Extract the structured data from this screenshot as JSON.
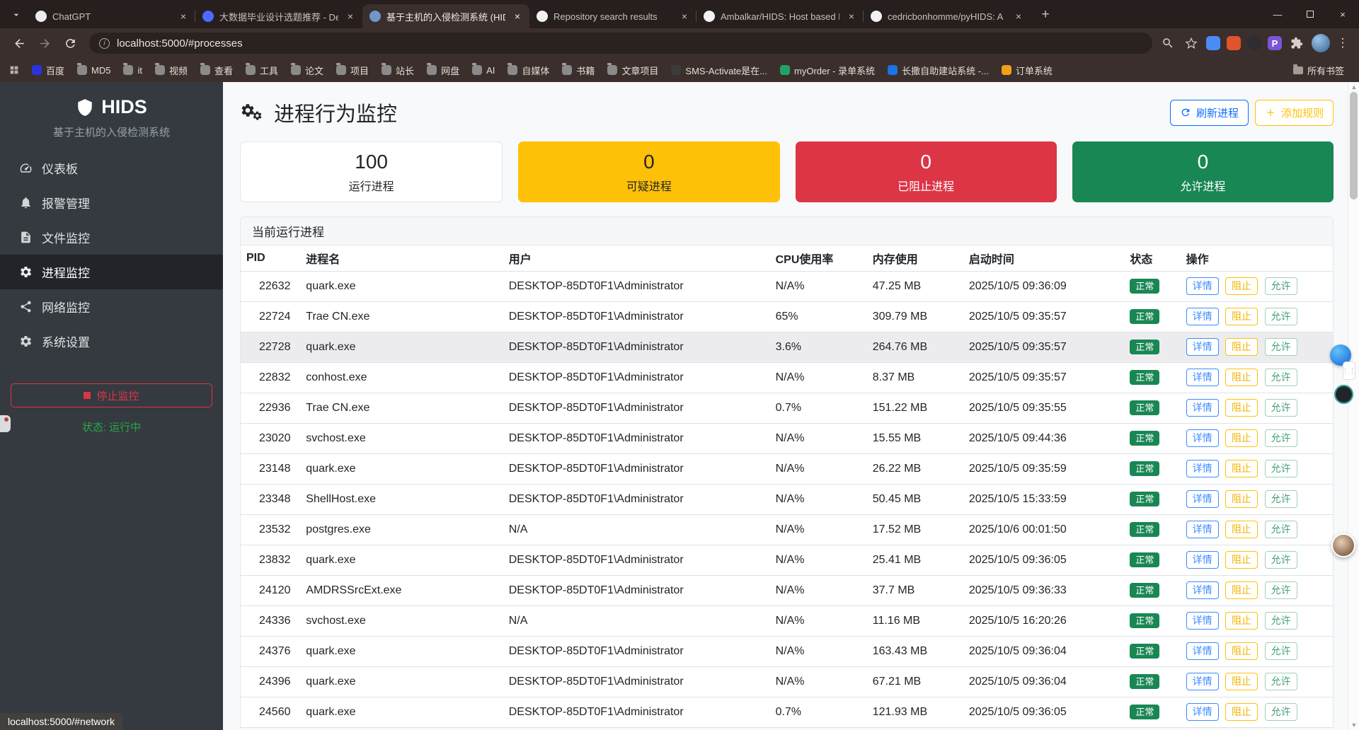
{
  "colors": {
    "primary": "#0d6efd",
    "warning": "#ffc107",
    "danger": "#dc3545",
    "success": "#198754",
    "sidebar_bg": "#343a40",
    "running_status": "#28a745"
  },
  "browser": {
    "tabs": [
      {
        "title": "ChatGPT",
        "favicon": "chatgpt",
        "active": false
      },
      {
        "title": "大数据毕业设计选题推荐 - Dee",
        "favicon": "deepseek",
        "active": false
      },
      {
        "title": "基于主机的入侵检测系统 (HID",
        "favicon": "hids",
        "active": true
      },
      {
        "title": "Repository search results",
        "favicon": "github",
        "active": false
      },
      {
        "title": "Ambalkar/HIDS: Host based I",
        "favicon": "github",
        "active": false
      },
      {
        "title": "cedricbonhomme/pyHIDS: A",
        "favicon": "github",
        "active": false
      }
    ],
    "url": "localhost:5000/#processes",
    "bookmarks": [
      {
        "label": "百度",
        "icon": "site",
        "color": "#2932e1"
      },
      {
        "label": "MD5",
        "icon": "folder"
      },
      {
        "label": "it",
        "icon": "folder"
      },
      {
        "label": "视频",
        "icon": "folder"
      },
      {
        "label": "查看",
        "icon": "folder"
      },
      {
        "label": "工具",
        "icon": "folder"
      },
      {
        "label": "论文",
        "icon": "folder"
      },
      {
        "label": "项目",
        "icon": "folder"
      },
      {
        "label": "站长",
        "icon": "folder"
      },
      {
        "label": "网盘",
        "icon": "folder"
      },
      {
        "label": "AI",
        "icon": "folder"
      },
      {
        "label": "自媒体",
        "icon": "folder"
      },
      {
        "label": "书籍",
        "icon": "folder"
      },
      {
        "label": "文章项目",
        "icon": "folder"
      },
      {
        "label": "SMS-Activate是在...",
        "icon": "site",
        "color": "#3b3b3b"
      },
      {
        "label": "myOrder - 录单系统",
        "icon": "site",
        "color": "#21a366"
      },
      {
        "label": "长撒自助建站系统 -...",
        "icon": "site",
        "color": "#1a73e8"
      },
      {
        "label": "订单系统",
        "icon": "site",
        "color": "#f0a11a"
      }
    ],
    "all_bookmarks": "所有书签",
    "status_bar_text": "localhost:5000/#network"
  },
  "sidebar": {
    "logo": "HIDS",
    "subtitle": "基于主机的入侵检测系统",
    "items": [
      {
        "label": "仪表板",
        "icon": "gauge-icon",
        "active": false
      },
      {
        "label": "报警管理",
        "icon": "bell-icon",
        "active": false
      },
      {
        "label": "文件监控",
        "icon": "file-icon",
        "active": false
      },
      {
        "label": "进程监控",
        "icon": "gears-icon",
        "active": true
      },
      {
        "label": "网络监控",
        "icon": "network-icon",
        "active": false
      },
      {
        "label": "系统设置",
        "icon": "gear-icon",
        "active": false
      }
    ],
    "stop_button": "停止监控",
    "status_label": "状态: 运行中"
  },
  "main": {
    "title": "进程行为监控",
    "refresh_button": "刷新进程",
    "add_rule_button": "添加规则",
    "stats": [
      {
        "value": "100",
        "label": "运行进程"
      },
      {
        "value": "0",
        "label": "可疑进程"
      },
      {
        "value": "0",
        "label": "已阻止进程"
      },
      {
        "value": "0",
        "label": "允许进程"
      }
    ],
    "table": {
      "title": "当前运行进程",
      "columns": [
        "PID",
        "进程名",
        "用户",
        "CPU使用率",
        "内存使用",
        "启动时间",
        "状态",
        "操作"
      ],
      "status_normal": "正常",
      "actions": [
        "详情",
        "阻止",
        "允许"
      ],
      "rows": [
        {
          "pid": "22632",
          "name": "quark.exe",
          "user": "DESKTOP-85DT0F1\\Administrator",
          "cpu": "N/A%",
          "mem": "47.25 MB",
          "started": "2025/10/5 09:36:09",
          "highlight": false
        },
        {
          "pid": "22724",
          "name": "Trae CN.exe",
          "user": "DESKTOP-85DT0F1\\Administrator",
          "cpu": "65%",
          "mem": "309.79 MB",
          "started": "2025/10/5 09:35:57",
          "highlight": false
        },
        {
          "pid": "22728",
          "name": "quark.exe",
          "user": "DESKTOP-85DT0F1\\Administrator",
          "cpu": "3.6%",
          "mem": "264.76 MB",
          "started": "2025/10/5 09:35:57",
          "highlight": true
        },
        {
          "pid": "22832",
          "name": "conhost.exe",
          "user": "DESKTOP-85DT0F1\\Administrator",
          "cpu": "N/A%",
          "mem": "8.37 MB",
          "started": "2025/10/5 09:35:57",
          "highlight": false
        },
        {
          "pid": "22936",
          "name": "Trae CN.exe",
          "user": "DESKTOP-85DT0F1\\Administrator",
          "cpu": "0.7%",
          "mem": "151.22 MB",
          "started": "2025/10/5 09:35:55",
          "highlight": false
        },
        {
          "pid": "23020",
          "name": "svchost.exe",
          "user": "DESKTOP-85DT0F1\\Administrator",
          "cpu": "N/A%",
          "mem": "15.55 MB",
          "started": "2025/10/5 09:44:36",
          "highlight": false
        },
        {
          "pid": "23148",
          "name": "quark.exe",
          "user": "DESKTOP-85DT0F1\\Administrator",
          "cpu": "N/A%",
          "mem": "26.22 MB",
          "started": "2025/10/5 09:35:59",
          "highlight": false
        },
        {
          "pid": "23348",
          "name": "ShellHost.exe",
          "user": "DESKTOP-85DT0F1\\Administrator",
          "cpu": "N/A%",
          "mem": "50.45 MB",
          "started": "2025/10/5 15:33:59",
          "highlight": false
        },
        {
          "pid": "23532",
          "name": "postgres.exe",
          "user": "N/A",
          "cpu": "N/A%",
          "mem": "17.52 MB",
          "started": "2025/10/6 00:01:50",
          "highlight": false
        },
        {
          "pid": "23832",
          "name": "quark.exe",
          "user": "DESKTOP-85DT0F1\\Administrator",
          "cpu": "N/A%",
          "mem": "25.41 MB",
          "started": "2025/10/5 09:36:05",
          "highlight": false
        },
        {
          "pid": "24120",
          "name": "AMDRSSrcExt.exe",
          "user": "DESKTOP-85DT0F1\\Administrator",
          "cpu": "N/A%",
          "mem": "37.7 MB",
          "started": "2025/10/5 09:36:33",
          "highlight": false
        },
        {
          "pid": "24336",
          "name": "svchost.exe",
          "user": "N/A",
          "cpu": "N/A%",
          "mem": "11.16 MB",
          "started": "2025/10/5 16:20:26",
          "highlight": false
        },
        {
          "pid": "24376",
          "name": "quark.exe",
          "user": "DESKTOP-85DT0F1\\Administrator",
          "cpu": "N/A%",
          "mem": "163.43 MB",
          "started": "2025/10/5 09:36:04",
          "highlight": false
        },
        {
          "pid": "24396",
          "name": "quark.exe",
          "user": "DESKTOP-85DT0F1\\Administrator",
          "cpu": "N/A%",
          "mem": "67.21 MB",
          "started": "2025/10/5 09:36:04",
          "highlight": false
        },
        {
          "pid": "24560",
          "name": "quark.exe",
          "user": "DESKTOP-85DT0F1\\Administrator",
          "cpu": "0.7%",
          "mem": "121.93 MB",
          "started": "2025/10/5 09:36:05",
          "highlight": false
        }
      ]
    }
  }
}
